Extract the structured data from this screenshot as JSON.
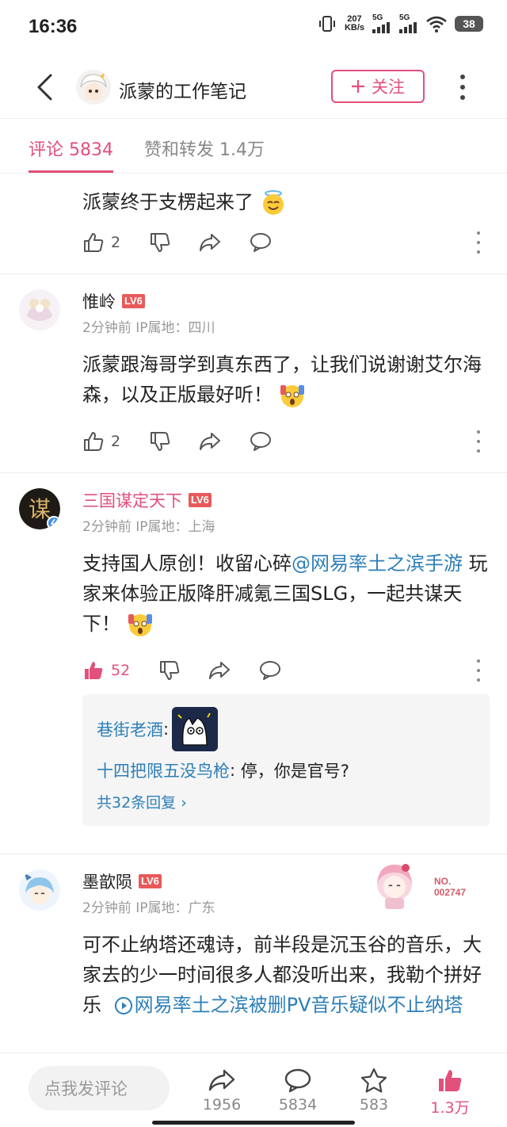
{
  "status_bar": {
    "time": "16:36",
    "net_speed_value": "207",
    "net_speed_unit": "KB/s",
    "signal1_label": "5G",
    "signal2_label": "5G",
    "battery": "38"
  },
  "header": {
    "account_name": "派蒙的工作笔记",
    "follow_label": "关注"
  },
  "tabs": {
    "comments": "评论 5834",
    "likes_reposts": "赞和转发 1.4万"
  },
  "comments": [
    {
      "text": "派蒙终于支楞起来了",
      "like_count": "2"
    },
    {
      "username": "惟岭",
      "level": "LV6",
      "meta": "2分钟前 IP属地：四川",
      "text": "派蒙跟海哥学到真东西了，让我们说谢谢艾尔海森，以及正版最好听！",
      "like_count": "2"
    },
    {
      "username": "三国谋定天下",
      "level": "LV6",
      "meta": "2分钟前 IP属地：上海",
      "text_before": "支持国人原创！收留心碎",
      "mention": "@网易率土之滨手游",
      "text_after": " 玩家来体验正版降肝减氪三国SLG，一起共谋天下！",
      "like_count": "52",
      "replies": [
        {
          "user": "巷街老酒",
          "text": ""
        },
        {
          "user": "十四把限五没鸟枪",
          "text": "停，你是官号?"
        }
      ],
      "replies_more": "共32条回复"
    },
    {
      "username": "墨歆陨",
      "level": "LV6",
      "meta": "2分钟前 IP属地：广东",
      "badge_no_label": "NO.",
      "badge_no": "002747",
      "text": "可不止纳塔还魂诗，前半段是沉玉谷的音乐，大家去的少一时间很多人都没听出来，我勒个拼好乐",
      "link_text": "网易率土之滨被删PV音乐疑似不止纳塔"
    }
  ],
  "bottom_bar": {
    "input_placeholder": "点我发评论",
    "reposts": "1956",
    "comments": "5834",
    "favorites": "583",
    "likes": "1.3万"
  },
  "colors": {
    "accent": "#e2507c",
    "link": "#2d7fb8",
    "level_badge": "#e85a5a"
  }
}
